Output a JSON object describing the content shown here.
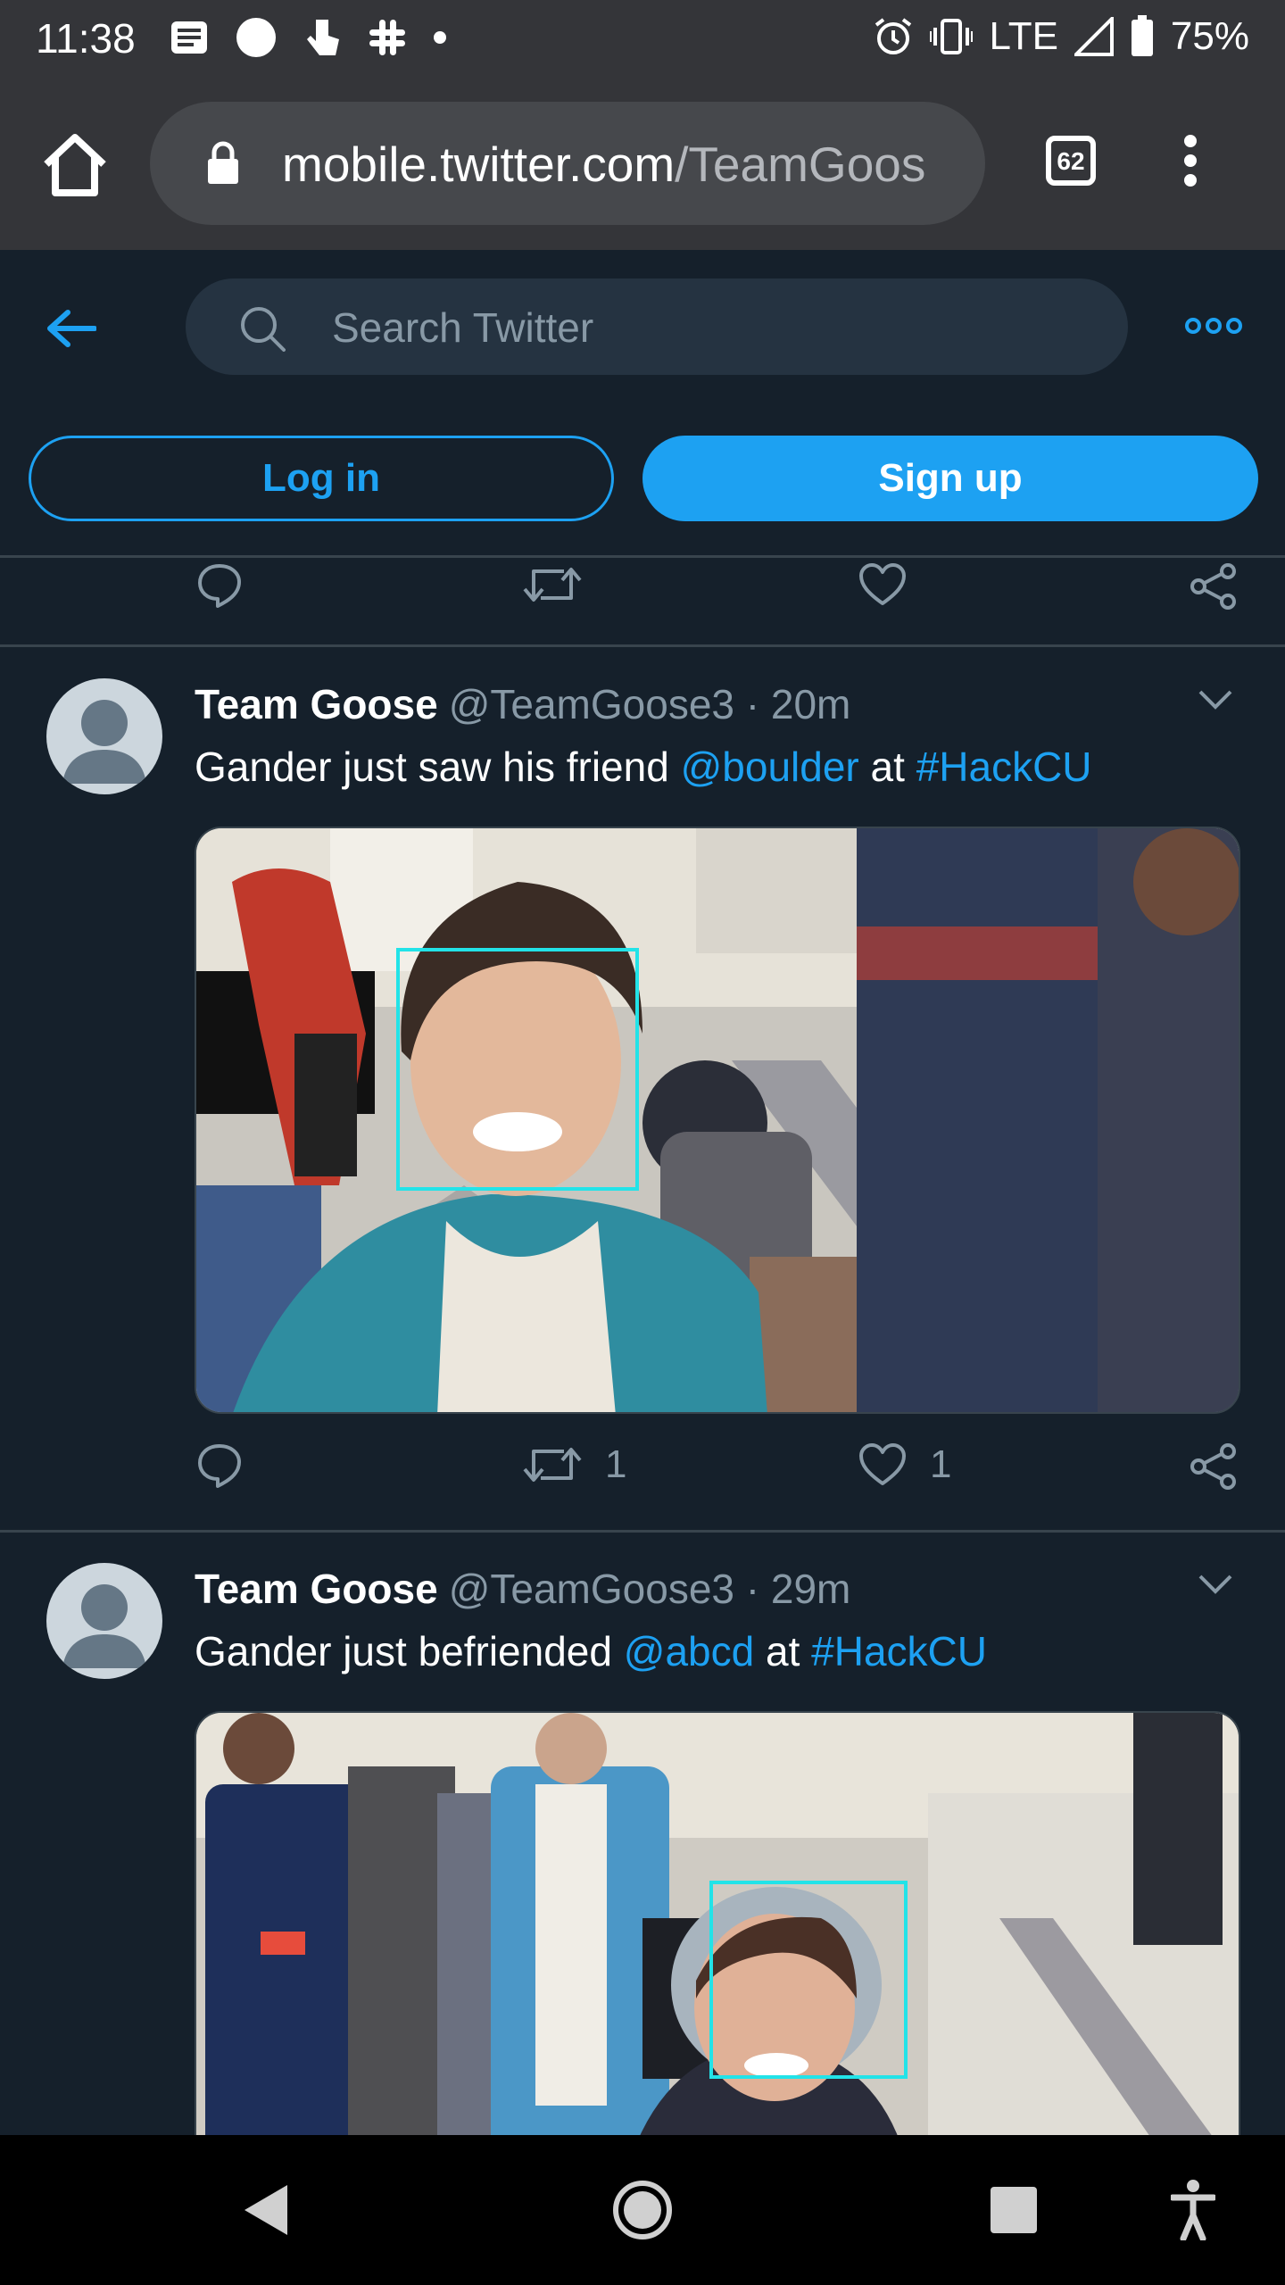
{
  "status_bar": {
    "time": "11:38",
    "network": "LTE",
    "battery": "75%"
  },
  "browser": {
    "url_domain": "mobile.twitter.com",
    "url_path": "/TeamGoos",
    "tab_count": "62"
  },
  "twitter_header": {
    "search_placeholder": "Search Twitter",
    "login_label": "Log in",
    "signup_label": "Sign up"
  },
  "colors": {
    "accent": "#1da1f2",
    "background": "#15202b",
    "face_box": "#22e3e8"
  },
  "tweets": [
    {
      "name": "Team Goose",
      "handle": "@TeamGoose3",
      "time": "· 20m",
      "text_before": "Gander just saw his friend ",
      "mention": "@boulder",
      "text_middle": " at ",
      "hashtag": "#HackCU",
      "retweets": "1",
      "likes": "1"
    },
    {
      "name": "Team Goose",
      "handle": "@TeamGoose3",
      "time": "· 29m",
      "text_before": "Gander just befriended ",
      "mention": "@abcd",
      "text_middle": " at ",
      "hashtag": "#HackCU"
    }
  ]
}
